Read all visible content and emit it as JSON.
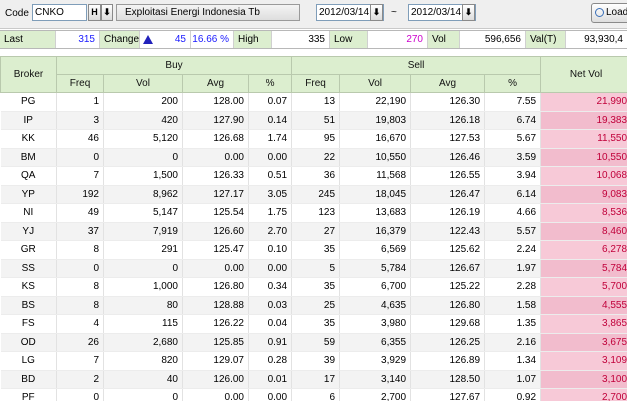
{
  "toolbar": {
    "code_label": "Code",
    "code_value": "CNKO",
    "h_button": "H",
    "arrow_button": "⬇",
    "company_name": "Exploitasi Energi Indonesia Tb",
    "date_from": "2012/03/14",
    "date_to": "2012/03/14",
    "separator": "~",
    "load_label": "Load"
  },
  "summary": {
    "last_label": "Last",
    "last_value": "315",
    "change_label": "Change",
    "change_value": "45",
    "change_pct": "16.66 %",
    "high_label": "High",
    "high_value": "335",
    "low_label": "Low",
    "low_value": "270",
    "vol_label": "Vol",
    "vol_value": "596,656",
    "valt_label": "Val(T)",
    "valt_value": "93,930,4"
  },
  "table": {
    "group_headers": {
      "broker": "Broker",
      "buy": "Buy",
      "sell": "Sell",
      "net": "Net Vol"
    },
    "sub_headers": {
      "freq": "Freq",
      "vol": "Vol",
      "avg": "Avg",
      "pct": "%"
    },
    "rows": [
      [
        "PG",
        "1",
        "200",
        "128.00",
        "0.07",
        "13",
        "22,190",
        "126.30",
        "7.55",
        "21,990"
      ],
      [
        "IP",
        "3",
        "420",
        "127.90",
        "0.14",
        "51",
        "19,803",
        "126.18",
        "6.74",
        "19,383"
      ],
      [
        "KK",
        "46",
        "5,120",
        "126.68",
        "1.74",
        "95",
        "16,670",
        "127.53",
        "5.67",
        "11,550"
      ],
      [
        "BM",
        "0",
        "0",
        "0.00",
        "0.00",
        "22",
        "10,550",
        "126.46",
        "3.59",
        "10,550"
      ],
      [
        "QA",
        "7",
        "1,500",
        "126.33",
        "0.51",
        "36",
        "11,568",
        "126.55",
        "3.94",
        "10,068"
      ],
      [
        "YP",
        "192",
        "8,962",
        "127.17",
        "3.05",
        "245",
        "18,045",
        "126.47",
        "6.14",
        "9,083"
      ],
      [
        "NI",
        "49",
        "5,147",
        "125.54",
        "1.75",
        "123",
        "13,683",
        "126.19",
        "4.66",
        "8,536"
      ],
      [
        "YJ",
        "37",
        "7,919",
        "126.60",
        "2.70",
        "27",
        "16,379",
        "122.43",
        "5.57",
        "8,460"
      ],
      [
        "GR",
        "8",
        "291",
        "125.47",
        "0.10",
        "35",
        "6,569",
        "125.62",
        "2.24",
        "6,278"
      ],
      [
        "SS",
        "0",
        "0",
        "0.00",
        "0.00",
        "5",
        "5,784",
        "126.67",
        "1.97",
        "5,784"
      ],
      [
        "KS",
        "8",
        "1,000",
        "126.80",
        "0.34",
        "35",
        "6,700",
        "125.22",
        "2.28",
        "5,700"
      ],
      [
        "BS",
        "8",
        "80",
        "128.88",
        "0.03",
        "25",
        "4,635",
        "126.80",
        "1.58",
        "4,555"
      ],
      [
        "FS",
        "4",
        "115",
        "126.22",
        "0.04",
        "35",
        "3,980",
        "129.68",
        "1.35",
        "3,865"
      ],
      [
        "OD",
        "26",
        "2,680",
        "125.85",
        "0.91",
        "59",
        "6,355",
        "126.25",
        "2.16",
        "3,675"
      ],
      [
        "LG",
        "7",
        "820",
        "129.07",
        "0.28",
        "39",
        "3,929",
        "126.89",
        "1.34",
        "3,109"
      ],
      [
        "BD",
        "2",
        "40",
        "126.00",
        "0.01",
        "17",
        "3,140",
        "128.50",
        "1.07",
        "3,100"
      ],
      [
        "PF",
        "0",
        "0",
        "0.00",
        "0.00",
        "6",
        "2,700",
        "127.67",
        "0.92",
        "2,700"
      ]
    ]
  },
  "colors": {
    "header_green": "#dceecf",
    "net_pink": "#f7c9d7",
    "net_text": "#c0003a",
    "up_triangle": "#2222bb"
  },
  "icons": {
    "change_indicator": "triangle-up-icon",
    "load": "refresh-icon"
  }
}
